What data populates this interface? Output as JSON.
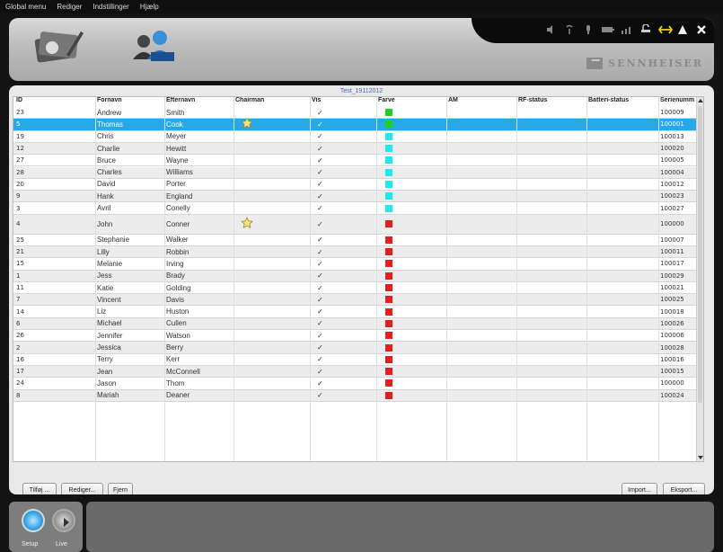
{
  "menu": [
    "Global menu",
    "Rediger",
    "Indstillinger",
    "Hjælp"
  ],
  "brand": "SENNHEISER",
  "grid_title": "Test_19112012",
  "columns": [
    "ID",
    "Fornavn",
    "Efternavn",
    "Chairman",
    "Vis",
    "Farve",
    "AM",
    "RF-status",
    "Batteri-status",
    "Serienumm"
  ],
  "check": "✓",
  "colors": {
    "green": "#1fd11f",
    "cyan": "#1fe8f2",
    "red": "#e51e1e",
    "selected": "#27a9e8"
  },
  "rows": [
    {
      "id": "23",
      "first": "Andrew",
      "last": "Smith",
      "chair": false,
      "color": "green",
      "serial": "100009"
    },
    {
      "id": "5",
      "first": "Thomas",
      "last": "Cook",
      "chair": true,
      "color": "green",
      "serial": "100001",
      "selected": true
    },
    {
      "id": "19",
      "first": "Chris",
      "last": "Meyer",
      "chair": false,
      "color": "cyan",
      "serial": "100013"
    },
    {
      "id": "12",
      "first": "Charlie",
      "last": "Hewitt",
      "chair": false,
      "color": "cyan",
      "serial": "100020"
    },
    {
      "id": "27",
      "first": "Bruce",
      "last": "Wayne",
      "chair": false,
      "color": "cyan",
      "serial": "100005"
    },
    {
      "id": "28",
      "first": "Charles",
      "last": "Williams",
      "chair": false,
      "color": "cyan",
      "serial": "100004"
    },
    {
      "id": "20",
      "first": "David",
      "last": "Porter",
      "chair": false,
      "color": "cyan",
      "serial": "100012"
    },
    {
      "id": "9",
      "first": "Hank",
      "last": "England",
      "chair": false,
      "color": "cyan",
      "serial": "100023"
    },
    {
      "id": "3",
      "first": "Avril",
      "last": "Conelly",
      "chair": false,
      "color": "cyan",
      "serial": "100027"
    },
    {
      "id": "4",
      "first": "John",
      "last": "Conner",
      "chair": true,
      "color": "red",
      "serial": "100000",
      "tall": true
    },
    {
      "id": "25",
      "first": "Stephanie",
      "last": "Walker",
      "chair": false,
      "color": "red",
      "serial": "100007"
    },
    {
      "id": "21",
      "first": "Lilly",
      "last": "Robbin",
      "chair": false,
      "color": "red",
      "serial": "100011"
    },
    {
      "id": "15",
      "first": "Melanie",
      "last": "Irving",
      "chair": false,
      "color": "red",
      "serial": "100017"
    },
    {
      "id": "1",
      "first": "Jess",
      "last": "Brady",
      "chair": false,
      "color": "red",
      "serial": "100029"
    },
    {
      "id": "11",
      "first": "Katie",
      "last": "Golding",
      "chair": false,
      "color": "red",
      "serial": "100021"
    },
    {
      "id": "7",
      "first": "Vincent",
      "last": "Davis",
      "chair": false,
      "color": "red",
      "serial": "100025"
    },
    {
      "id": "14",
      "first": "Liz",
      "last": "Huston",
      "chair": false,
      "color": "red",
      "serial": "100018"
    },
    {
      "id": "6",
      "first": "Michael",
      "last": "Cullen",
      "chair": false,
      "color": "red",
      "serial": "100026"
    },
    {
      "id": "26",
      "first": "Jennifer",
      "last": "Watson",
      "chair": false,
      "color": "red",
      "serial": "100006"
    },
    {
      "id": "2",
      "first": "Jessica",
      "last": "Berry",
      "chair": false,
      "color": "red",
      "serial": "100028"
    },
    {
      "id": "16",
      "first": "Terry",
      "last": "Kerr",
      "chair": false,
      "color": "red",
      "serial": "100016"
    },
    {
      "id": "17",
      "first": "Jean",
      "last": "McConnell",
      "chair": false,
      "color": "red",
      "serial": "100015"
    },
    {
      "id": "24",
      "first": "Jason",
      "last": "Thom",
      "chair": false,
      "color": "red",
      "serial": "100000"
    },
    {
      "id": "8",
      "first": "Mariah",
      "last": "Deaner",
      "chair": false,
      "color": "red",
      "serial": "100024"
    }
  ],
  "buttons": {
    "add": "Tilføj ...",
    "edit": "Rediger...",
    "remove": "Fjern",
    "import": "Import...",
    "export": "Eksport..."
  },
  "modes": {
    "setup": "Setup",
    "live": "Live"
  },
  "icons": [
    "volume-icon",
    "antenna-icon",
    "mic-icon",
    "battery-icon",
    "signal-icon",
    "lock-icon",
    "link-icon",
    "warning-icon",
    "close-icon"
  ]
}
